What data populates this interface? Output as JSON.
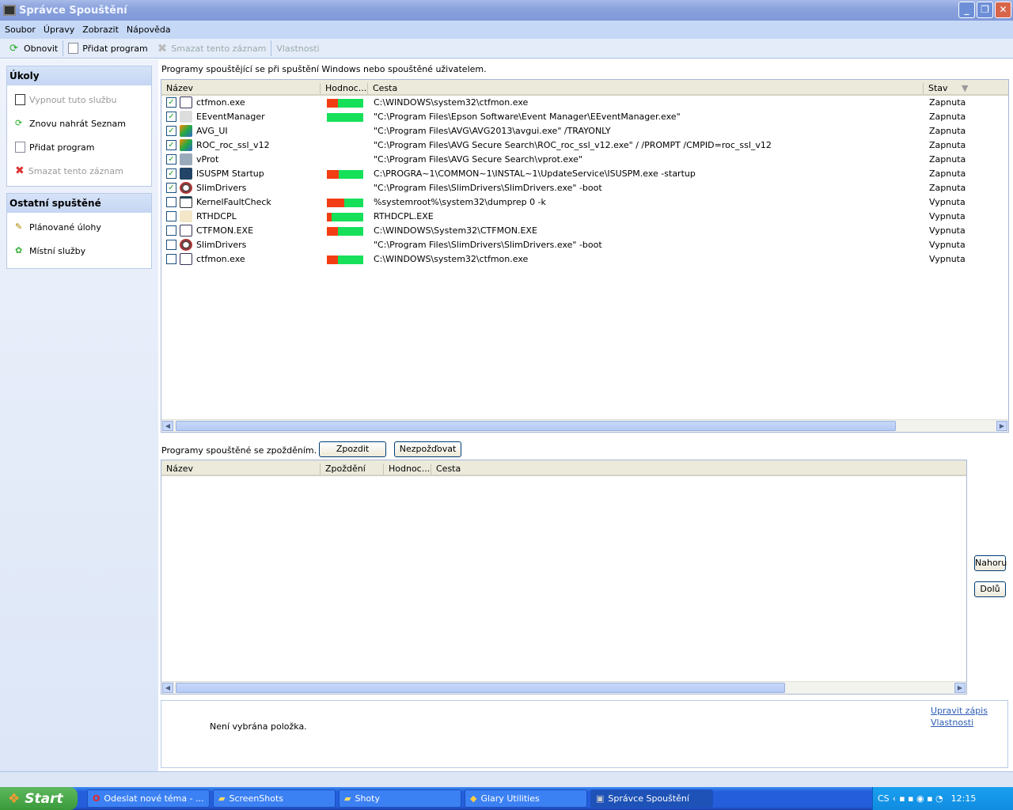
{
  "window": {
    "title": "Správce Spouštění"
  },
  "menu": [
    "Soubor",
    "Úpravy",
    "Zobrazit",
    "Nápověda"
  ],
  "toolbar": {
    "refresh": "Obnovit",
    "add": "Přidat program",
    "delete": "Smazat tento záznam",
    "properties": "Vlastnosti"
  },
  "tasks": {
    "title": "Úkoly",
    "items": [
      "Vypnout tuto službu",
      "Znovu nahrát Seznam",
      "Přidat program",
      "Smazat tento záznam"
    ]
  },
  "other": {
    "title": "Ostatní spuštěné",
    "items": [
      "Plánované úlohy",
      "Místní služby"
    ]
  },
  "startup": {
    "caption": "Programy spouštějící se při spuštění Windows nebo spouštěné uživatelem.",
    "columns": [
      "Název",
      "Hodnoc...",
      "Cesta",
      "Stav"
    ],
    "rows": [
      {
        "checked": true,
        "name": "ctfmon.exe",
        "rating_red": 0.3,
        "path": "C:\\WINDOWS\\system32\\ctfmon.exe",
        "status": "Zapnuta",
        "icon": "pen"
      },
      {
        "checked": true,
        "name": "EEventManager",
        "rating_red": 0,
        "path": "\"C:\\Program Files\\Epson Software\\Event Manager\\EEventManager.exe\"",
        "status": "Zapnuta",
        "icon": "epson"
      },
      {
        "checked": true,
        "name": "AVG_UI",
        "rating_red": null,
        "path": "\"C:\\Program Files\\AVG\\AVG2013\\avgui.exe\" /TRAYONLY",
        "status": "Zapnuta",
        "icon": "avg"
      },
      {
        "checked": true,
        "name": "ROC_roc_ssl_v12",
        "rating_red": null,
        "path": "\"C:\\Program Files\\AVG Secure Search\\ROC_roc_ssl_v12.exe\" / /PROMPT /CMPID=roc_ssl_v12",
        "status": "Zapnuta",
        "icon": "avg"
      },
      {
        "checked": true,
        "name": "vProt",
        "rating_red": null,
        "path": "\"C:\\Program Files\\AVG Secure Search\\vprot.exe\"",
        "status": "Zapnuta",
        "icon": "installer"
      },
      {
        "checked": true,
        "name": "ISUSPM Startup",
        "rating_red": 0.33,
        "path": "C:\\PROGRA~1\\COMMON~1\\INSTAL~1\\UpdateService\\ISUSPM.exe -startup",
        "status": "Zapnuta",
        "icon": "isus"
      },
      {
        "checked": true,
        "name": "SlimDrivers",
        "rating_red": null,
        "path": "\"C:\\Program Files\\SlimDrivers\\SlimDrivers.exe\" -boot",
        "status": "Zapnuta",
        "icon": "slim"
      },
      {
        "checked": false,
        "name": "KernelFaultCheck",
        "rating_red": 0.47,
        "path": "%systemroot%\\system32\\dumprep 0 -k",
        "status": "Vypnuta",
        "icon": "window"
      },
      {
        "checked": false,
        "name": "RTHDCPL",
        "rating_red": 0.13,
        "path": "RTHDCPL.EXE",
        "status": "Vypnuta",
        "icon": "speaker"
      },
      {
        "checked": false,
        "name": "CTFMON.EXE",
        "rating_red": 0.3,
        "path": "C:\\WINDOWS\\System32\\CTFMON.EXE",
        "status": "Vypnuta",
        "icon": "pen"
      },
      {
        "checked": false,
        "name": "SlimDrivers",
        "rating_red": null,
        "path": "\"C:\\Program Files\\SlimDrivers\\SlimDrivers.exe\" -boot",
        "status": "Vypnuta",
        "icon": "slim"
      },
      {
        "checked": false,
        "name": "ctfmon.exe",
        "rating_red": 0.3,
        "path": "C:\\WINDOWS\\system32\\ctfmon.exe",
        "status": "Vypnuta",
        "icon": "pen"
      }
    ]
  },
  "delayed": {
    "caption": "Programy spouštěné se zpožděním.",
    "delay_button": "Zpozdit",
    "nodelay_button": "Nezpožďovat",
    "columns": [
      "Název",
      "Zpoždění",
      "Hodnoc...",
      "Cesta"
    ],
    "up": "Nahoru",
    "down": "Dolů"
  },
  "details": {
    "empty": "Není vybrána položka.",
    "edit_link": "Upravit zápis",
    "properties_link": "Vlastnosti"
  },
  "taskbar": {
    "start": "Start",
    "items": [
      "Odeslat nové téma - ...",
      "ScreenShots",
      "Shoty",
      "Glary Utilities",
      "Správce Spouštění"
    ],
    "lang": "CS",
    "clock": "12:15"
  },
  "colors": {
    "rating_bad": "#f23d14",
    "rating_good": "#16e05a"
  }
}
